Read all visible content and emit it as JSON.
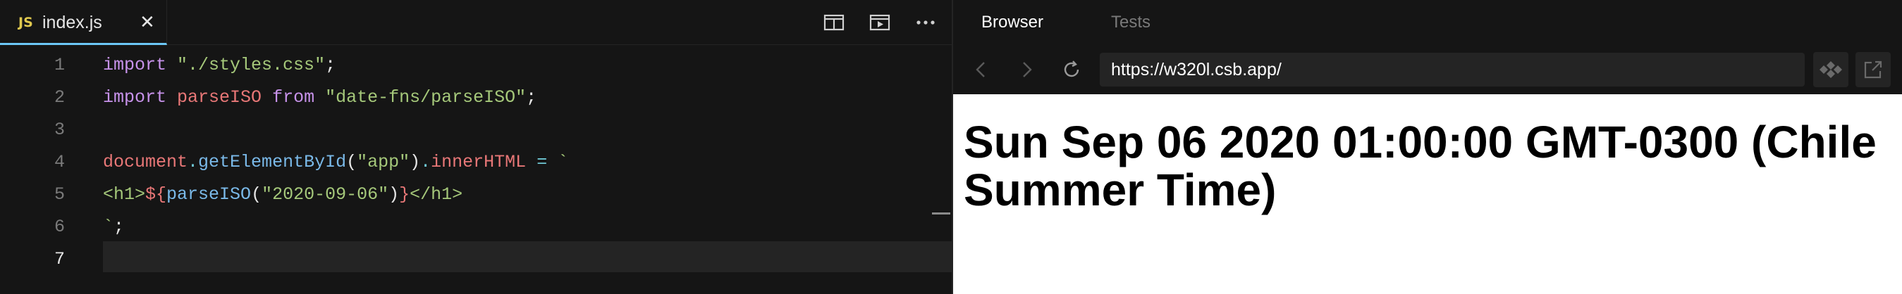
{
  "editor": {
    "tab": {
      "lang_badge": "JS",
      "filename": "index.js",
      "close_glyph": "✕"
    },
    "toolbar_icons": [
      "split-view-icon",
      "preview-icon",
      "more-options-icon"
    ],
    "active_line": 7,
    "lines": [
      {
        "number": "1"
      },
      {
        "number": "2"
      },
      {
        "number": "3"
      },
      {
        "number": "4"
      },
      {
        "number": "5"
      },
      {
        "number": "6"
      },
      {
        "number": "7"
      }
    ],
    "code": {
      "l1": {
        "kw": "import",
        "sp": " ",
        "str": "\"./styles.css\"",
        "end": ";"
      },
      "l2": {
        "kw": "import",
        "sp1": " ",
        "ident": "parseISO",
        "sp2": " ",
        "kw2": "from",
        "sp3": " ",
        "str": "\"date-fns/parseISO\"",
        "end": ";"
      },
      "l4": {
        "obj": "document",
        "dot": ".",
        "fn": "getElementById",
        "p1": "(",
        "str": "\"app\"",
        "p2": ")",
        "dot2": ".",
        "prop": "innerHTML",
        "eq": " = ",
        "tick": "`"
      },
      "l5": {
        "open": "<h1>",
        "interp": "${",
        "fn": "parseISO",
        "p1": "(",
        "str": "\"2020-09-06\"",
        "p2": ")",
        "close_interp": "}",
        "close": "</h1>"
      },
      "l6": {
        "tick": "`",
        "end": ";"
      }
    }
  },
  "browser": {
    "tabs": [
      {
        "label": "Browser",
        "active": true
      },
      {
        "label": "Tests",
        "active": false
      }
    ],
    "url": "https://w320l.csb.app/",
    "nav_icons": [
      "back-icon",
      "forward-icon",
      "refresh-icon"
    ],
    "heading": "Sun Sep 06 2020 01:00:00 GMT-0300 (Chile Summer Time)"
  },
  "colors": {
    "background": "#151515",
    "tab_underline": "#6cc7f6",
    "keyword": "#c792ea",
    "string": "#a5c87a",
    "identifier": "#e87777",
    "function": "#7ab9e8",
    "operator": "#6fc8d4",
    "line_number": "#7a7a7a"
  }
}
